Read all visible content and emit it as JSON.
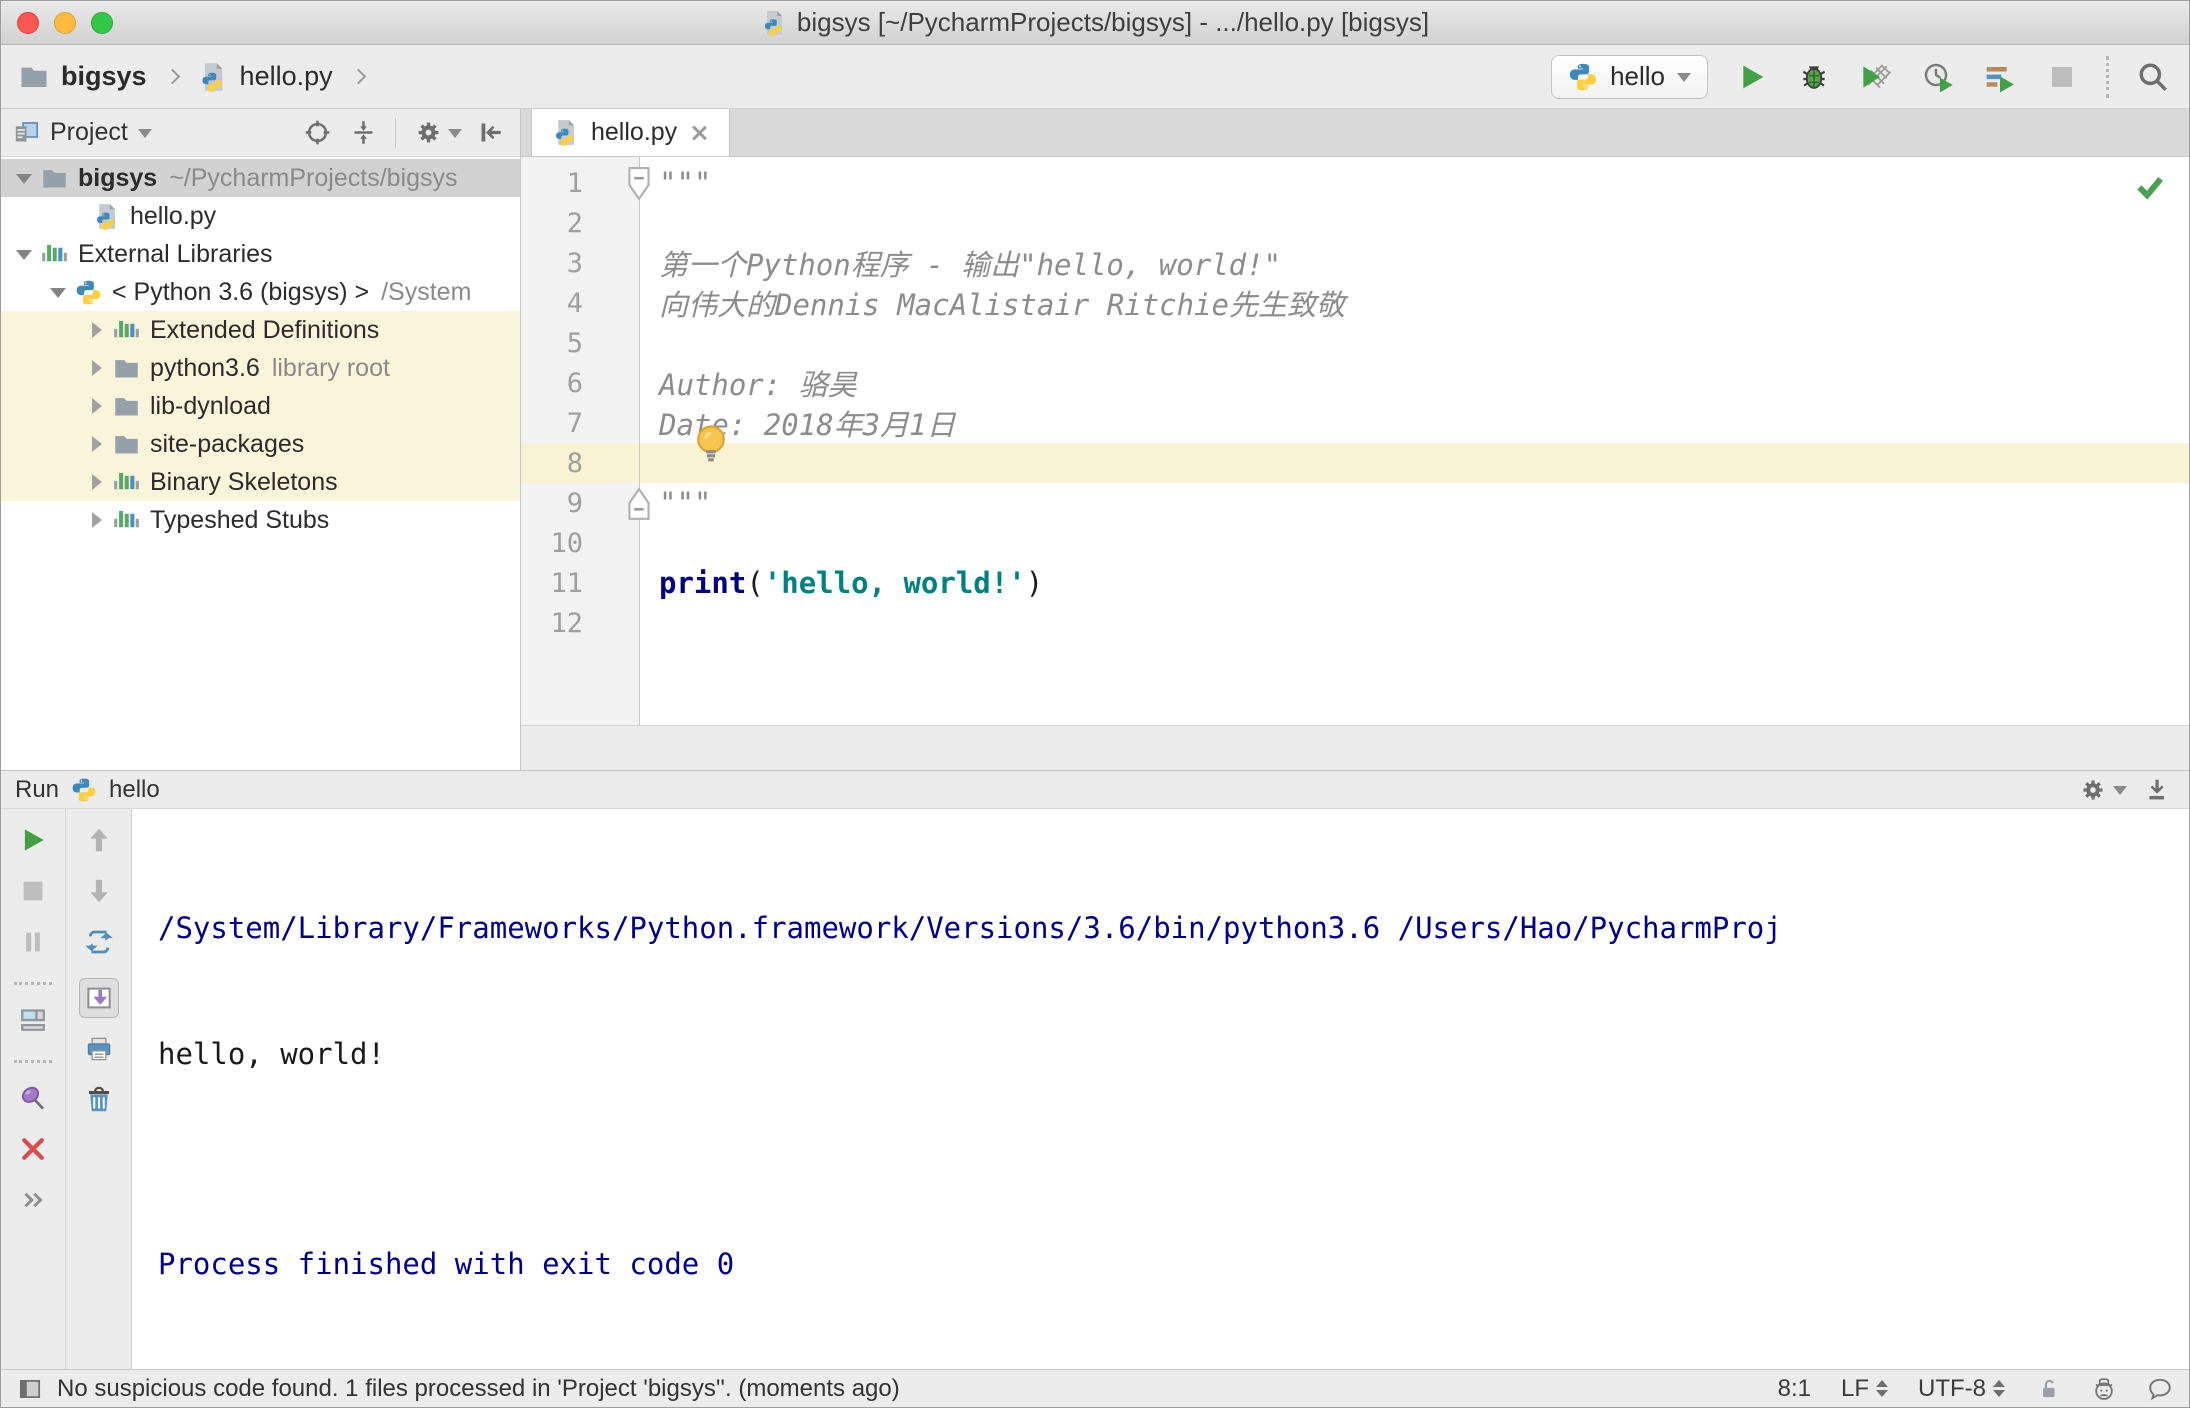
{
  "window": {
    "title": "bigsys [~/PycharmProjects/bigsys] - .../hello.py [bigsys]"
  },
  "breadcrumbs": {
    "project": "bigsys",
    "file": "hello.py"
  },
  "toolbar": {
    "run_config": "hello"
  },
  "project_panel": {
    "title": "Project",
    "tree": [
      {
        "label": "bigsys",
        "annotation": "~/PycharmProjects/bigsys"
      },
      {
        "label": "hello.py"
      },
      {
        "label": "External Libraries"
      },
      {
        "label": "< Python 3.6 (bigsys) >",
        "annotation": "/System"
      },
      {
        "label": "Extended Definitions"
      },
      {
        "label": "python3.6",
        "annotation": "library root"
      },
      {
        "label": "lib-dynload"
      },
      {
        "label": "site-packages"
      },
      {
        "label": "Binary Skeletons"
      },
      {
        "label": "Typeshed Stubs"
      }
    ]
  },
  "editor": {
    "tab": "hello.py",
    "lines": [
      {
        "num": "1",
        "text": "\"\"\""
      },
      {
        "num": "2",
        "text": ""
      },
      {
        "num": "3",
        "text": "第一个Python程序 - 输出\"hello, world!\""
      },
      {
        "num": "4",
        "text": "向伟大的Dennis MacAlistair Ritchie先生致敬"
      },
      {
        "num": "5",
        "text": ""
      },
      {
        "num": "6",
        "text": "Author: 骆昊"
      },
      {
        "num": "7",
        "text": "Date: 2018年3月1日"
      },
      {
        "num": "8",
        "text": ""
      },
      {
        "num": "9",
        "text": "\"\"\""
      },
      {
        "num": "10",
        "text": ""
      },
      {
        "num": "11",
        "segments": [
          {
            "t": "print"
          },
          {
            "t": "("
          },
          {
            "t": "'hello, world!'"
          },
          {
            "t": ")"
          }
        ]
      },
      {
        "num": "12",
        "text": ""
      }
    ]
  },
  "run_panel": {
    "label": "Run",
    "config": "hello",
    "console": [
      {
        "text": "/System/Library/Frameworks/Python.framework/Versions/3.6/bin/python3.6 /Users/Hao/PycharmProj"
      },
      {
        "text": "hello, world!"
      },
      {
        "text": ""
      },
      {
        "text": "Process finished with exit code 0"
      }
    ]
  },
  "status_bar": {
    "message": "No suspicious code found. 1 files processed in 'Project 'bigsys''. (moments ago)",
    "caret": "8:1",
    "line_separator": "LF",
    "encoding": "UTF-8"
  }
}
